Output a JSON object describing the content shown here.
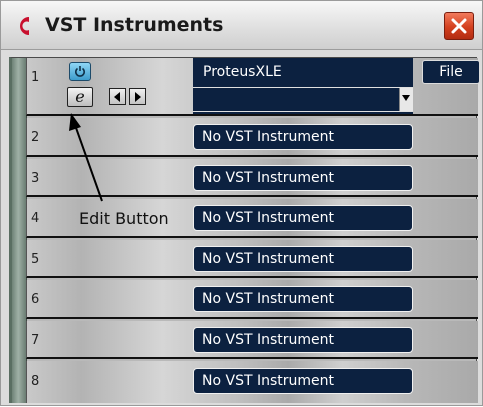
{
  "window": {
    "title": "VST Instruments",
    "logo_icon": "cubase-logo-icon",
    "close_icon": "close-icon"
  },
  "slots": [
    {
      "number": "1",
      "instrument": "ProteusXLE",
      "preset": "",
      "file_label": "File"
    },
    {
      "number": "2",
      "instrument": "No VST Instrument"
    },
    {
      "number": "3",
      "instrument": "No VST Instrument"
    },
    {
      "number": "4",
      "instrument": "No VST Instrument"
    },
    {
      "number": "5",
      "instrument": "No VST Instrument"
    },
    {
      "number": "6",
      "instrument": "No VST Instrument"
    },
    {
      "number": "7",
      "instrument": "No VST Instrument"
    },
    {
      "number": "8",
      "instrument": "No VST Instrument"
    }
  ],
  "slot1_controls": {
    "power_icon": "power-icon",
    "edit_glyph": "e",
    "prev_icon": "arrow-left-icon",
    "next_icon": "arrow-right-icon"
  },
  "annotation": {
    "label": "Edit Button"
  },
  "colors": {
    "field_bg": "#0c2140",
    "power_active": "#5bb6e2",
    "close_red": "#d3401f"
  }
}
